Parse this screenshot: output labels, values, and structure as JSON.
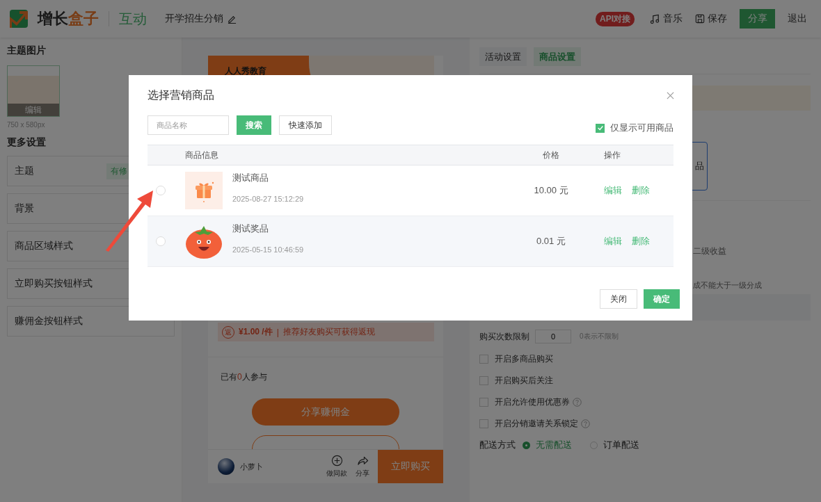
{
  "header": {
    "logo": {
      "name_dark": "增长",
      "name_accent": "盒子"
    },
    "module": "互动",
    "title": "开学招生分销",
    "api_badge": "API对接",
    "actions": [
      {
        "kind": "music",
        "label": "音乐"
      },
      {
        "kind": "save",
        "label": "保存"
      }
    ],
    "share_button": "分享",
    "exit": "退出"
  },
  "left_panel": {
    "theme_image_title": "主题图片",
    "thumbnail_edit": "编辑",
    "thumbnail_size": "750 x 580px",
    "more_settings_title": "更多设置",
    "items": [
      {
        "label": "主题",
        "badge": "有修"
      },
      {
        "label": "背景"
      },
      {
        "label": "商品区域样式"
      },
      {
        "label": "立即购买按钮样式"
      },
      {
        "label": "赚佣金按钮样式"
      }
    ]
  },
  "preview": {
    "banner_text": "人人秀教育",
    "promo": {
      "badge": "返",
      "price": "¥1.00 /件",
      "separator": "|",
      "text": "推荐好友购买可获得返现"
    },
    "participants": {
      "before": "已有",
      "count": "0",
      "after": "人参与"
    },
    "commission_button": "分享赚佣金",
    "bottom_bar": {
      "user": "小萝卜",
      "actions": [
        {
          "kind": "plus",
          "label": "做同款"
        },
        {
          "kind": "share",
          "label": "分享"
        }
      ],
      "buy_button": "立即购买"
    }
  },
  "settings_panel": {
    "tabs": [
      {
        "label": "活动设置",
        "selected": false
      },
      {
        "label": "商品设置",
        "selected": true
      }
    ],
    "product_card_text": "品",
    "level_two_text": "二级收益",
    "ratio_hint": "成不能大于一级分成",
    "purchase_limit": {
      "label": "购买次数限制",
      "value": "0",
      "hint": "0表示不限制"
    },
    "options": [
      {
        "label": "开启多商品购买",
        "checked": false,
        "help": false
      },
      {
        "label": "开启购买后关注",
        "checked": false,
        "help": false
      },
      {
        "label": "开启允许使用优惠券",
        "checked": false,
        "help": true
      },
      {
        "label": "开启分销邀请关系锁定",
        "checked": false,
        "help": true
      }
    ],
    "delivery": {
      "label": "配送方式",
      "choices": [
        {
          "label": "无需配送",
          "selected": true
        },
        {
          "label": "订单配送",
          "selected": false
        }
      ]
    }
  },
  "modal": {
    "title": "选择营销商品",
    "search": {
      "placeholder": "商品名称"
    },
    "search_button": "搜索",
    "quick_add_button": "快速添加",
    "available_only": {
      "label": "仅显示可用商品",
      "checked": true
    },
    "table": {
      "columns": [
        "商品信息",
        "价格",
        "操作"
      ],
      "rows": [
        {
          "selected": false,
          "name": "测试商品",
          "time": "2025-08-27 15:12:29",
          "price": "10.00 元",
          "actions": [
            "编辑",
            "删除"
          ]
        },
        {
          "selected": false,
          "name": "测试奖品",
          "time": "2025-05-15 10:46:59",
          "price": "0.01 元",
          "actions": [
            "编辑",
            "删除"
          ]
        }
      ]
    },
    "buttons": {
      "close": "关闭",
      "confirm": "确定"
    }
  }
}
